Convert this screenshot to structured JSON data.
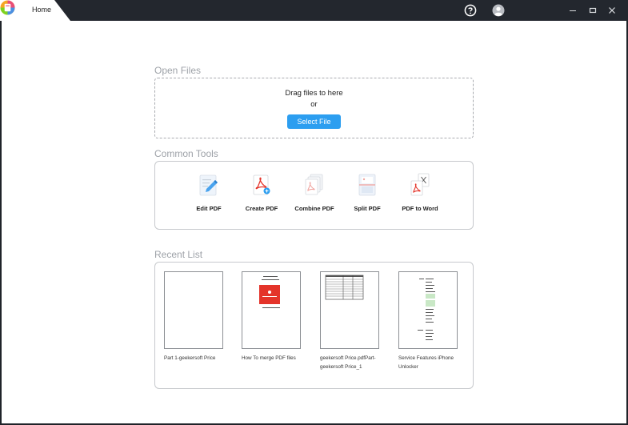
{
  "titlebar": {
    "tab_label": "Home",
    "icons": [
      "app-logo-icon",
      "help-icon",
      "user-icon",
      "minimize-icon",
      "maximize-icon",
      "close-icon"
    ]
  },
  "open_files": {
    "title": "Open Files",
    "drag_text": "Drag files to here",
    "or_text": "or",
    "select_button": "Select File"
  },
  "common_tools": {
    "title": "Common Tools",
    "tools": [
      {
        "label": "Edit PDF",
        "icon": "edit-pdf-icon"
      },
      {
        "label": "Create PDF",
        "icon": "create-pdf-icon"
      },
      {
        "label": "Combine PDF",
        "icon": "combine-pdf-icon"
      },
      {
        "label": "Split PDF",
        "icon": "split-pdf-icon"
      },
      {
        "label": "PDF to Word",
        "icon": "pdf-to-word-icon"
      }
    ]
  },
  "recent_list": {
    "title": "Recent List",
    "items": [
      {
        "name": "Part 1-geekersoft Price"
      },
      {
        "name": "How To merge PDF files"
      },
      {
        "name": "geekersoft Price.pdfPart-geekersoft Price_1"
      },
      {
        "name": "Service Features iPhone Unlocker"
      }
    ]
  },
  "colors": {
    "accent": "#2c9ef0",
    "titlebar": "#23272e",
    "section_title": "#9ea2a8"
  }
}
